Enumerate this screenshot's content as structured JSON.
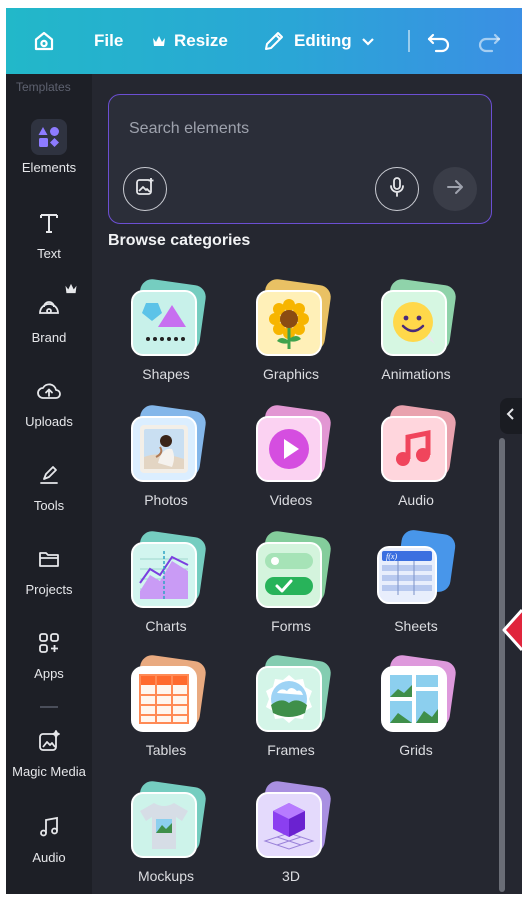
{
  "toolbar": {
    "file_label": "File",
    "resize_label": "Resize",
    "editing_label": "Editing"
  },
  "sidebar": {
    "faded_label": "Templates",
    "items": [
      {
        "label": "Elements",
        "icon": "elements-icon"
      },
      {
        "label": "Text",
        "icon": "text-icon"
      },
      {
        "label": "Brand",
        "icon": "brand-icon"
      },
      {
        "label": "Uploads",
        "icon": "upload-icon"
      },
      {
        "label": "Tools",
        "icon": "tools-icon"
      },
      {
        "label": "Projects",
        "icon": "folder-icon"
      },
      {
        "label": "Apps",
        "icon": "apps-icon"
      },
      {
        "label": "Magic Media",
        "icon": "magic-media-icon"
      },
      {
        "label": "Audio",
        "icon": "music-icon"
      }
    ]
  },
  "search": {
    "placeholder": "Search elements"
  },
  "browse": {
    "title": "Browse categories"
  },
  "categories": [
    {
      "label": "Shapes"
    },
    {
      "label": "Graphics"
    },
    {
      "label": "Animations"
    },
    {
      "label": "Photos"
    },
    {
      "label": "Videos"
    },
    {
      "label": "Audio"
    },
    {
      "label": "Charts"
    },
    {
      "label": "Forms"
    },
    {
      "label": "Sheets"
    },
    {
      "label": "Tables"
    },
    {
      "label": "Frames"
    },
    {
      "label": "Grids"
    },
    {
      "label": "Mockups"
    },
    {
      "label": "3D"
    }
  ],
  "colors": {
    "toolbar_gradient_start": "#22b8c9",
    "toolbar_gradient_end": "#3b8fe4",
    "panel_bg": "#252730",
    "sidebar_bg": "#1d1f26",
    "search_border": "#6c4fd3"
  }
}
